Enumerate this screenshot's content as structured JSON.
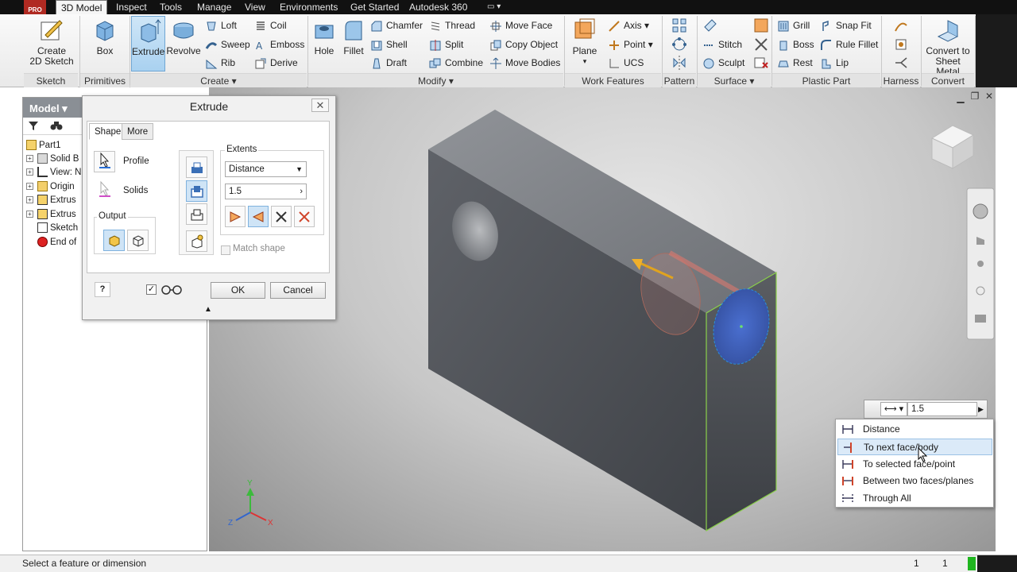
{
  "colors": {
    "tabbar": "#111111",
    "accent": "#2a8bd6",
    "selected_face": "#3d5fb7",
    "highlight_edge": "#8ad04b",
    "arrow": "#e0a31f"
  },
  "app_badge": "PRO",
  "tabs": [
    {
      "label": "3D Model",
      "active": true
    },
    {
      "label": "Inspect"
    },
    {
      "label": "Tools"
    },
    {
      "label": "Manage"
    },
    {
      "label": "View"
    },
    {
      "label": "Environments"
    },
    {
      "label": "Get Started"
    },
    {
      "label": "Autodesk 360"
    }
  ],
  "ribbon": {
    "sketch": {
      "create_label_1": "Create",
      "create_label_2": "2D Sketch",
      "panel": "Sketch"
    },
    "primitives": {
      "box": "Box",
      "panel": "Primitives"
    },
    "create": {
      "extrude": "Extrude",
      "revolve": "Revolve",
      "loft": "Loft",
      "sweep": "Sweep",
      "rib": "Rib",
      "coil": "Coil",
      "emboss": "Emboss",
      "derive": "Derive",
      "panel": "Create"
    },
    "modify": {
      "hole": "Hole",
      "fillet": "Fillet",
      "chamfer": "Chamfer",
      "shell": "Shell",
      "draft": "Draft",
      "thread": "Thread",
      "split": "Split",
      "combine": "Combine",
      "move_face": "Move Face",
      "copy_object": "Copy Object",
      "move_bodies": "Move Bodies",
      "panel": "Modify"
    },
    "work_features": {
      "plane": "Plane",
      "axis": "Axis",
      "point": "Point",
      "ucs": "UCS",
      "panel": "Work Features"
    },
    "pattern": {
      "panel": "Pattern"
    },
    "surface": {
      "stitch": "Stitch",
      "sculpt": "Sculpt",
      "panel": "Surface"
    },
    "plastic": {
      "grill": "Grill",
      "boss": "Boss",
      "rest": "Rest",
      "snap_fit": "Snap Fit",
      "rule_fillet": "Rule Fillet",
      "lip": "Lip",
      "panel": "Plastic Part"
    },
    "harness": {
      "panel": "Harness"
    },
    "convert": {
      "label_1": "Convert to",
      "label_2": "Sheet Metal",
      "panel": "Convert"
    }
  },
  "browser": {
    "title": "Model",
    "items": [
      {
        "label": "Part1",
        "expander": ""
      },
      {
        "label": "Solid B",
        "expander": "+"
      },
      {
        "label": "View: N",
        "expander": "+"
      },
      {
        "label": "Origin",
        "expander": "+"
      },
      {
        "label": "Extrus",
        "expander": "+"
      },
      {
        "label": "Extrus",
        "expander": "+"
      },
      {
        "label": "Sketch",
        "expander": ""
      },
      {
        "label": "End of",
        "expander": ""
      }
    ]
  },
  "dialog": {
    "title": "Extrude",
    "tabs": {
      "shape": "Shape",
      "more": "More"
    },
    "profile": "Profile",
    "solids": "Solids",
    "output": "Output",
    "extents": {
      "label": "Extents",
      "type": "Distance",
      "value": "1.5",
      "match_shape": "Match shape"
    },
    "ok": "OK",
    "cancel": "Cancel"
  },
  "minibar": {
    "value": "1.5"
  },
  "extents_menu": [
    {
      "label": "Distance",
      "highlighted": false
    },
    {
      "label": "To next face/body",
      "highlighted": true
    },
    {
      "label": "To selected face/point",
      "highlighted": false
    },
    {
      "label": "Between two faces/planes",
      "highlighted": false
    },
    {
      "label": "Through All",
      "highlighted": false
    }
  ],
  "triad": {
    "x": "X",
    "y": "Y",
    "z": "Z"
  },
  "status": {
    "text": "Select a feature or dimension",
    "count_1": "1",
    "count_2": "1"
  }
}
